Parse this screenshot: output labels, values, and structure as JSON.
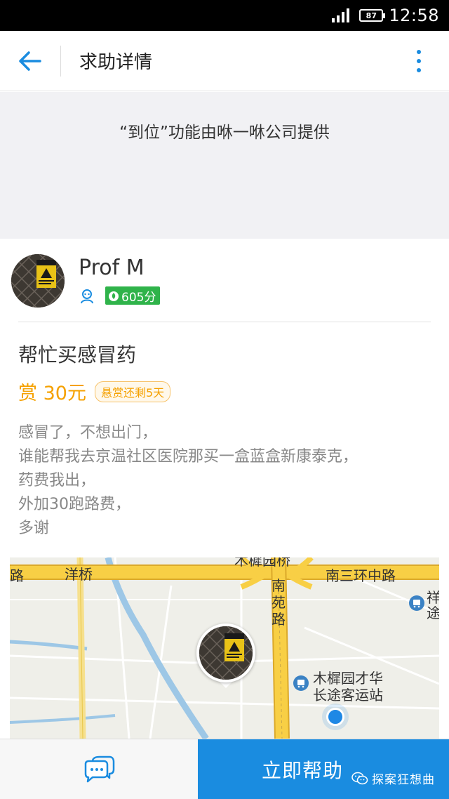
{
  "status_bar": {
    "battery": "87",
    "time": "12:58"
  },
  "header": {
    "title": "求助详情"
  },
  "banner": {
    "text": "“到位”功能由咻一咻公司提供"
  },
  "profile": {
    "name": "Prof M",
    "score": "605分"
  },
  "task": {
    "title": "帮忙买感冒药",
    "reward": "赏 30元",
    "reward_badge": "悬赏还剩5天",
    "description": [
      "感冒了，不想出门，",
      "谁能帮我去京温社区医院那买一盒蓝盒新康泰克，",
      "药费我出，",
      "外加30跑路费，",
      "多谢"
    ]
  },
  "map": {
    "labels": {
      "yangqiao": "洋桥",
      "road_left": "路",
      "road_top": "木樨园桥",
      "nansanhuan": "南三环中路",
      "nanyuanlu": "南苑路",
      "station": "木樨园才华",
      "station2": "长途客运站",
      "xiang": "祥",
      "tu": "途"
    }
  },
  "bottom": {
    "help_label": "立即帮助",
    "watermark": "探案狂想曲"
  },
  "colors": {
    "accent": "#1a8ce0",
    "reward": "#f5a100",
    "score": "#2fb34a"
  }
}
